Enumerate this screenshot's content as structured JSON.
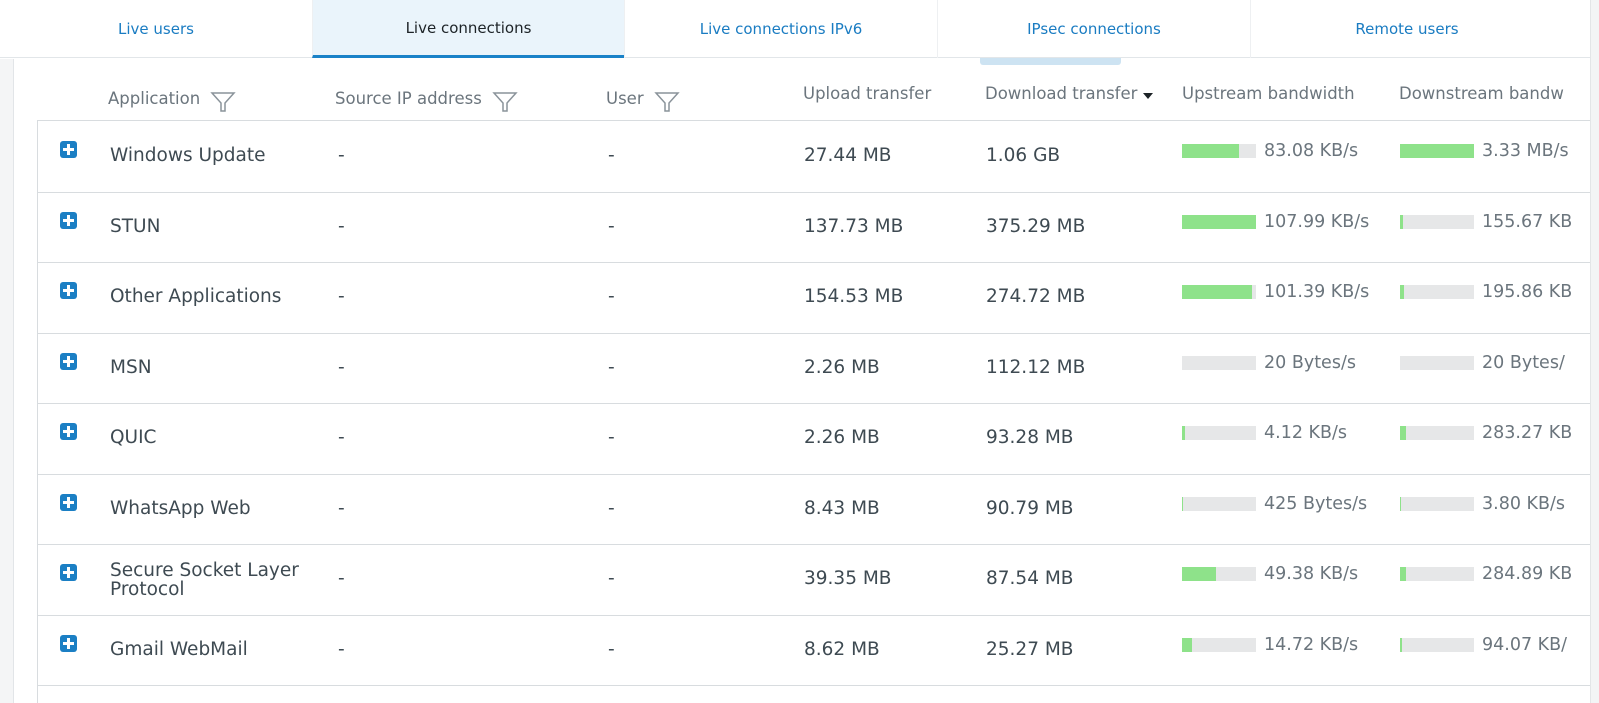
{
  "tabs": [
    {
      "label": "Live users",
      "active": false
    },
    {
      "label": "Live connections",
      "active": true
    },
    {
      "label": "Live connections IPv6",
      "active": false
    },
    {
      "label": "IPsec connections",
      "active": false
    },
    {
      "label": "Remote users",
      "active": false
    }
  ],
  "columns": {
    "application": "Application",
    "source_ip": "Source IP address",
    "user": "User",
    "upload": "Upload transfer",
    "download": "Download transfer",
    "upstream": "Upstream bandwidth",
    "downstream": "Downstream bandw"
  },
  "colors": {
    "accent": "#1a7cc2",
    "bar_fill": "#8ee28a",
    "bar_track": "#e6e7e8"
  },
  "rows": [
    {
      "app": "Windows Update",
      "src": "-",
      "user": "-",
      "upload": "27.44 MB",
      "download": "1.06 GB",
      "up_bw": "83.08 KB/s",
      "up_level": 0.77,
      "down_bw": "3.33 MB/s",
      "down_level": 1.0
    },
    {
      "app": "STUN",
      "src": "-",
      "user": "-",
      "upload": "137.73 MB",
      "download": "375.29 MB",
      "up_bw": "107.99 KB/s",
      "up_level": 1.0,
      "down_bw": "155.67 KB",
      "down_level": 0.04
    },
    {
      "app": "Other Applications",
      "src": "-",
      "user": "-",
      "upload": "154.53 MB",
      "download": "274.72 MB",
      "up_bw": "101.39 KB/s",
      "up_level": 0.94,
      "down_bw": "195.86 KB",
      "down_level": 0.05
    },
    {
      "app": "MSN",
      "src": "-",
      "user": "-",
      "upload": "2.26 MB",
      "download": "112.12 MB",
      "up_bw": "20 Bytes/s",
      "up_level": 0.0,
      "down_bw": "20 Bytes/",
      "down_level": 0.0
    },
    {
      "app": "QUIC",
      "src": "-",
      "user": "-",
      "upload": "2.26 MB",
      "download": "93.28 MB",
      "up_bw": "4.12 KB/s",
      "up_level": 0.04,
      "down_bw": "283.27 KB",
      "down_level": 0.08
    },
    {
      "app": "WhatsApp Web",
      "src": "-",
      "user": "-",
      "upload": "8.43 MB",
      "download": "90.79 MB",
      "up_bw": "425 Bytes/s",
      "up_level": 0.01,
      "down_bw": "3.80 KB/s",
      "down_level": 0.01
    },
    {
      "app": "Secure Socket Layer",
      "app_line2": "Protocol",
      "src": "-",
      "user": "-",
      "upload": "39.35 MB",
      "download": "87.54 MB",
      "up_bw": "49.38 KB/s",
      "up_level": 0.46,
      "down_bw": "284.89 KB",
      "down_level": 0.08
    },
    {
      "app": "Gmail WebMail",
      "src": "-",
      "user": "-",
      "upload": "8.62 MB",
      "download": "25.27 MB",
      "up_bw": "14.72 KB/s",
      "up_level": 0.14,
      "down_bw": "94.07 KB/",
      "down_level": 0.03
    }
  ]
}
